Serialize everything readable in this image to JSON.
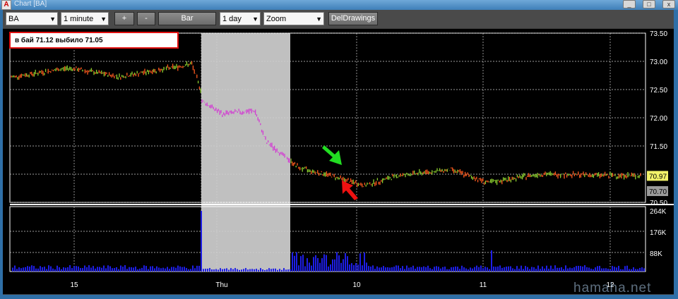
{
  "window": {
    "title": "Chart [BA]",
    "icon": "A",
    "minimize": "_",
    "maximize": "□",
    "close": "x"
  },
  "toolbar": {
    "symbol": "BA",
    "interval": "1 minute",
    "plus": "+",
    "minus": "-",
    "chart_type": "Bar",
    "range": "1 day",
    "zoom": "Zoom",
    "del_drawings": "DelDrawings"
  },
  "annotation": "в бай 71.12 выбило 71.05",
  "watermark": "hamaha.net",
  "colors": {
    "up": "#8ccf2e",
    "down": "#ff5a1e",
    "flat": "#d23cd2",
    "volume": "#1e1ee6",
    "shade": "#c0c0c0",
    "last_price_bg": "#f2f26a",
    "stop_bg": "#9a9a9a"
  },
  "chart_data": {
    "type": "bar",
    "symbol": "BA",
    "price_axis": {
      "ticks": [
        "73.50",
        "73.00",
        "72.50",
        "72.00",
        "71.50",
        "71.00",
        "70.50"
      ],
      "range": [
        70.5,
        73.5
      ]
    },
    "volume_axis": {
      "ticks": [
        "264K",
        "176K",
        "88K"
      ]
    },
    "x_labels": [
      "15",
      "Thu",
      "10",
      "11",
      "12"
    ],
    "last_price": "70.97",
    "stop_level": "70.70",
    "series": [
      {
        "start": 72.72,
        "end": 72.88,
        "n": 46,
        "trend": "flat"
      },
      {
        "start": 72.88,
        "end": 72.73,
        "n": 40,
        "trend": "flat"
      },
      {
        "start": 72.73,
        "end": 72.9,
        "n": 44,
        "trend": "flat"
      },
      {
        "start": 72.9,
        "end": 72.95,
        "n": 12,
        "trend": "flat"
      },
      {
        "start": 72.95,
        "end": 72.5,
        "n": 8,
        "trend": "down"
      },
      {
        "start": 72.3,
        "end": 72.05,
        "n": 18,
        "trend": "flat"
      },
      {
        "start": 72.08,
        "end": 72.12,
        "n": 24,
        "trend": "flat"
      },
      {
        "start": 72.1,
        "end": 71.55,
        "n": 10,
        "trend": "down"
      },
      {
        "start": 71.55,
        "end": 71.1,
        "n": 26,
        "trend": "down"
      },
      {
        "start": 71.1,
        "end": 71.0,
        "n": 20,
        "trend": "flat"
      },
      {
        "start": 71.0,
        "end": 70.8,
        "n": 30,
        "trend": "down"
      },
      {
        "start": 70.8,
        "end": 70.98,
        "n": 28,
        "trend": "up"
      },
      {
        "start": 70.98,
        "end": 71.08,
        "n": 40,
        "trend": "up"
      },
      {
        "start": 71.08,
        "end": 70.85,
        "n": 30,
        "trend": "down"
      },
      {
        "start": 70.85,
        "end": 71.0,
        "n": 40,
        "trend": "up"
      },
      {
        "start": 71.0,
        "end": 70.97,
        "n": 80,
        "trend": "flat"
      }
    ]
  }
}
